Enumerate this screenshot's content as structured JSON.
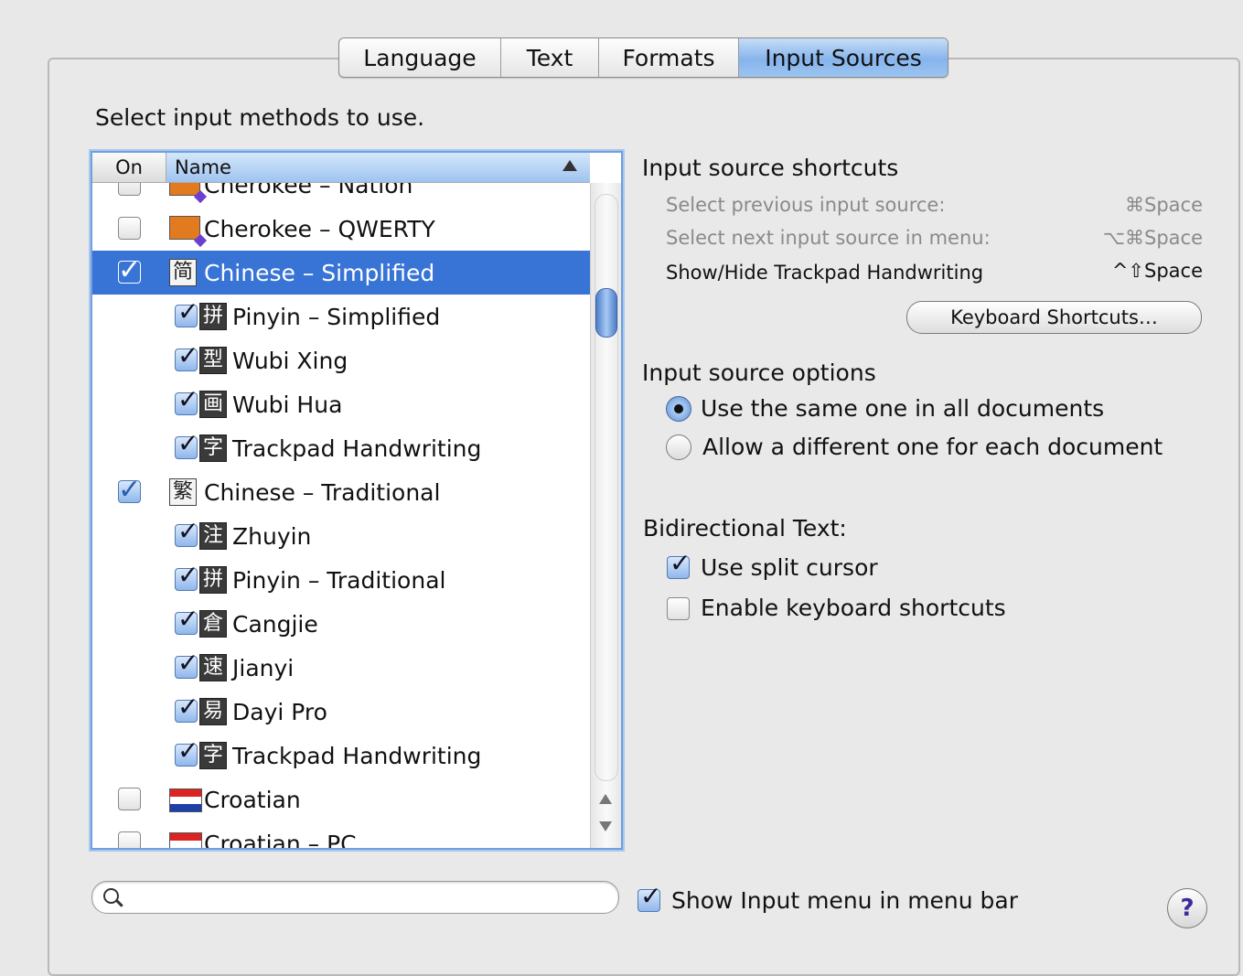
{
  "tabs": [
    {
      "label": "Language"
    },
    {
      "label": "Text"
    },
    {
      "label": "Formats"
    },
    {
      "label": "Input Sources"
    }
  ],
  "instruction": "Select input methods to use.",
  "list": {
    "col_on": "On",
    "col_name": "Name",
    "rows": [
      {
        "label": "Cherokee – Nation",
        "level": 0,
        "checked": false,
        "icon": "cherokee-flag-icon"
      },
      {
        "label": "Cherokee – QWERTY",
        "level": 0,
        "checked": false,
        "icon": "cherokee-flag-icon"
      },
      {
        "label": "Chinese – Simplified",
        "level": 0,
        "checked": true,
        "icon": "简",
        "selected": true
      },
      {
        "label": "Pinyin – Simplified",
        "level": 1,
        "checked": true,
        "icon": "拼"
      },
      {
        "label": "Wubi Xing",
        "level": 1,
        "checked": true,
        "icon": "型"
      },
      {
        "label": "Wubi Hua",
        "level": 1,
        "checked": true,
        "icon": "画"
      },
      {
        "label": "Trackpad Handwriting",
        "level": 1,
        "checked": true,
        "icon": "字"
      },
      {
        "label": "Chinese – Traditional",
        "level": 0,
        "checked": true,
        "icon": "繁"
      },
      {
        "label": "Zhuyin",
        "level": 1,
        "checked": true,
        "icon": "注"
      },
      {
        "label": "Pinyin – Traditional",
        "level": 1,
        "checked": true,
        "icon": "拼"
      },
      {
        "label": "Cangjie",
        "level": 1,
        "checked": true,
        "icon": "倉"
      },
      {
        "label": "Jianyi",
        "level": 1,
        "checked": true,
        "icon": "速"
      },
      {
        "label": "Dayi Pro",
        "level": 1,
        "checked": true,
        "icon": "易"
      },
      {
        "label": "Trackpad Handwriting",
        "level": 1,
        "checked": true,
        "icon": "字"
      },
      {
        "label": "Croatian",
        "level": 0,
        "checked": false,
        "icon": "croatia-flag-icon"
      },
      {
        "label": "Croatian – PC",
        "level": 0,
        "checked": false,
        "icon": "croatia-flag-icon"
      }
    ]
  },
  "shortcuts": {
    "title": "Input source shortcuts",
    "items": [
      {
        "label": "Select previous input source:",
        "key": "⌘Space",
        "enabled": false
      },
      {
        "label": "Select next input source in menu:",
        "key": "⌥⌘Space",
        "enabled": false
      },
      {
        "label": "Show/Hide Trackpad Handwriting",
        "key": "^⇧Space",
        "enabled": true
      }
    ],
    "button": "Keyboard Shortcuts…"
  },
  "options": {
    "title": "Input source options",
    "same": "Use the same one in all documents",
    "different": "Allow a different one for each document",
    "selected": "same"
  },
  "bidi": {
    "title": "Bidirectional Text:",
    "split_cursor": "Use split cursor",
    "split_cursor_checked": true,
    "kbd_shortcuts": "Enable keyboard shortcuts",
    "kbd_shortcuts_checked": false
  },
  "search": {
    "value": ""
  },
  "show_menu": {
    "label": "Show Input menu in menu bar",
    "checked": true
  },
  "help": "?"
}
